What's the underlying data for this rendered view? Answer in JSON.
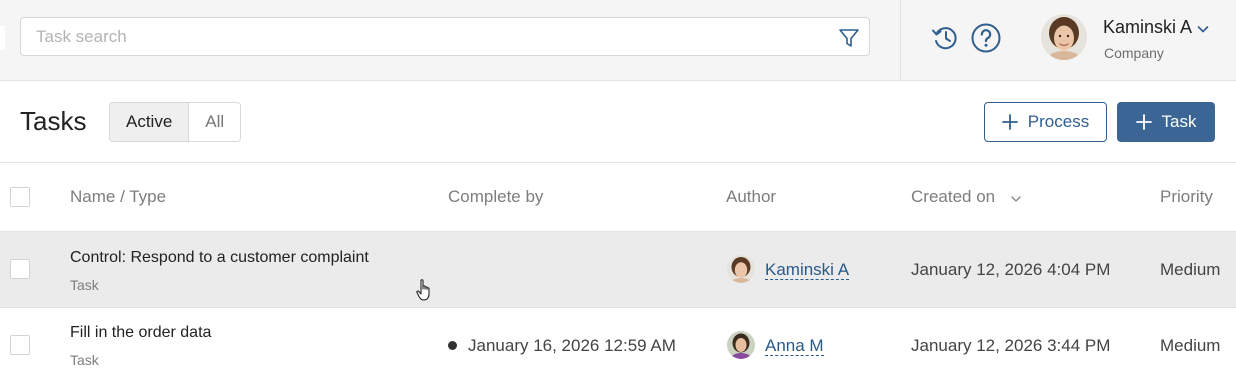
{
  "header": {
    "search": {
      "placeholder": "Task search",
      "value": ""
    },
    "icons": [
      "filter-icon",
      "history-icon",
      "help-icon",
      "chevron-down-icon"
    ],
    "user": {
      "name": "Kaminski A",
      "company": "Company"
    }
  },
  "toolbar": {
    "title": "Tasks",
    "filter_tabs": [
      {
        "label": "Active",
        "selected": true
      },
      {
        "label": "All",
        "selected": false
      }
    ],
    "process_button": "Process",
    "task_button": "Task"
  },
  "table": {
    "columns": [
      "Name / Type",
      "Complete by",
      "Author",
      "Created on",
      "Priority"
    ],
    "sorted_by": "Created on",
    "rows": [
      {
        "name": "Control: Respond to a customer complaint",
        "type": "Task",
        "complete_by": "",
        "author": "Kaminski A",
        "created_on": "January 12, 2026 4:04 PM",
        "priority": "Medium",
        "hovered": true
      },
      {
        "name": "Fill in the order data",
        "type": "Task",
        "complete_by": "January 16, 2026 12:59 AM",
        "author": "Anna M",
        "created_on": "January 12, 2026 3:44 PM",
        "priority": "Medium",
        "hovered": false
      }
    ]
  },
  "colors": {
    "accent": "#3a6594",
    "link": "#2a5a8c",
    "topbar_bg": "#f5f5f5",
    "hover_row_bg": "#ebebeb"
  }
}
